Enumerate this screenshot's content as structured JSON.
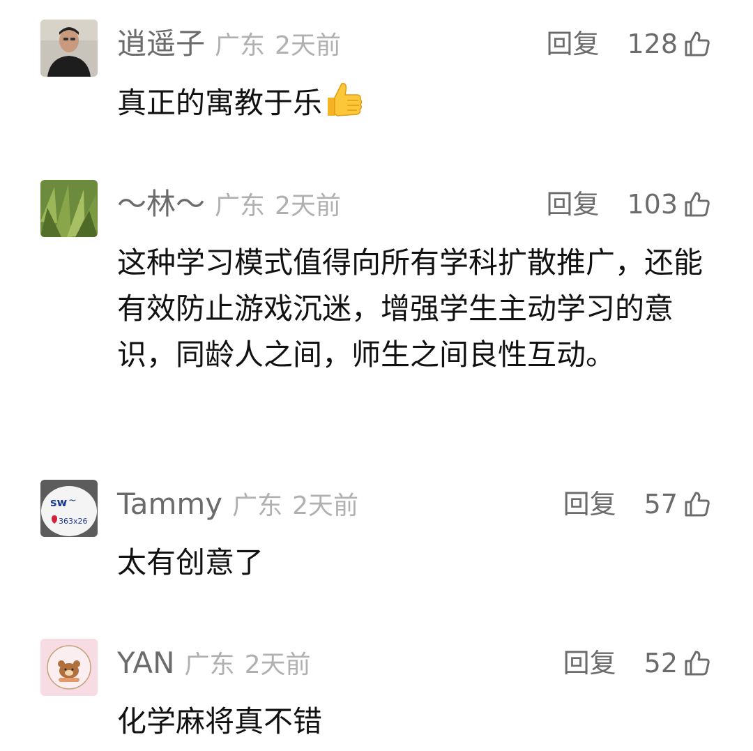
{
  "comments": [
    {
      "username": "逍遥子",
      "location": "广东",
      "time": "2天前",
      "reply_label": "回复",
      "likes": "128",
      "text": "真正的寓教于乐",
      "emoji": "thumbs-up"
    },
    {
      "username": "～林～",
      "location": "广东",
      "time": "2天前",
      "reply_label": "回复",
      "likes": "103",
      "text": "这种学习模式值得向所有学科扩散推广，还能有效防止游戏沉迷，增强学生主动学习的意识，同龄人之间，师生之间良性互动。"
    },
    {
      "username": "Tammy",
      "location": "广东",
      "time": "2天前",
      "reply_label": "回复",
      "likes": "57",
      "text": "太有创意了"
    },
    {
      "username": "YAN",
      "location": "广东",
      "time": "2天前",
      "reply_label": "回复",
      "likes": "52",
      "text": "化学麻将真不错"
    }
  ],
  "icons": {
    "like": "thumbs-up-outline-icon",
    "emoji": "thumbs-up-emoji"
  },
  "colors": {
    "username": "#6b6b6b",
    "meta": "#b0b0b0",
    "text": "#111111",
    "background": "#ffffff"
  }
}
